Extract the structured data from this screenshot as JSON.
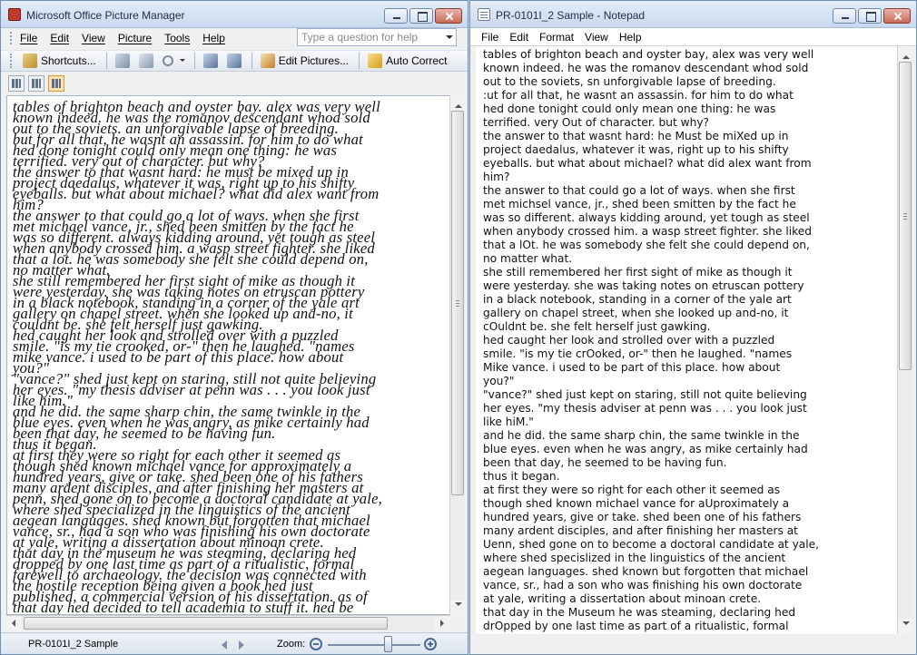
{
  "picture_manager": {
    "title": "Microsoft Office Picture Manager",
    "menu": [
      "File",
      "Edit",
      "View",
      "Picture",
      "Tools",
      "Help"
    ],
    "help_placeholder": "Type a question for help",
    "toolbar": {
      "shortcuts_label": "Shortcuts...",
      "edit_pictures_label": "Edit Pictures...",
      "auto_correct_label": "Auto Correct"
    },
    "document_lines": [
      "tables of brighton beach and oyster bay. alex was very well",
      "known indeed. he was the romanov descendant whod sold",
      "out to the soviets. an unforgivable lapse of breeding.",
      "but for all that, he wasnt an assassin. for him to do what",
      "hed done tonight could only mean one thing: he was",
      "terrified. very out of character. but why?",
      "the answer to that wasnt hard: he must be mixed up in",
      "project daedalus, whatever it was, right up to his shifty",
      "eyeballs. but what about michael? what did alex want from",
      "him?",
      "the answer to that could go a lot of ways. when she first",
      "met michael vance, jr., shed been smitten by the fact he",
      "was so different. always kidding around, yet tough as steel",
      "when anybody crossed him. a wasp street fighter. she liked",
      "that a lot. he was somebody she felt she could depend on,",
      "no matter what.",
      "she still remembered her first sight of mike as though it",
      "were yesterday. she was taking notes on etruscan pottery",
      "in a black notebook, standing in a corner of the yale art",
      "gallery on chapel street. when she looked up and-no, it",
      "couldnt be. she felt herself just gawking.",
      "hed caught her look and strolled over with a puzzled",
      "smile. \"is my tie crooked, or-\" then he laughed. \"names",
      "mike vance. i used to be part of this place. how about",
      "you?\"",
      "\"vance?\" shed just kept on staring, still not quite believing",
      "her eyes. \"my thesis adviser at penn was . . . you look just",
      "like him.\"",
      "and he did. the same sharp chin, the same twinkle in the",
      "blue eyes. even when he was angry, as mike certainly had",
      "been that day, he seemed to be having fun.",
      "thus it began.",
      "at first they were so right for each other it seemed as",
      "though shed known michael vance for approximately a",
      "hundred years, give or take. shed been one of his fathers",
      "many ardent disciples, and after finishing her masters at",
      "penn, shed gone on to become a doctoral candidate at yale,",
      "where shed specialized in the linguistics of the ancient",
      "aegean languages. shed known but forgotten that michael",
      "vance, sr., had a son who was finishing his own doctorate",
      "at yale, writing a dissertation about minoan crete.",
      "that day in the museum he was steaming, declaring hed",
      "dropped by one last time as part of a ritualistic, formal",
      "farewell to archaeology. the decision was connected with",
      "the hostile reception being given a book hed just",
      "published, a commercial version of his dissertation. as of",
      "that day hed decided to tell academia to stuff it. hed be"
    ],
    "status": {
      "file_name": "PR-0101I_2 Sample",
      "zoom_label": "Zoom:",
      "zoom_level": 0.66
    }
  },
  "notepad": {
    "title": "PR-0101I_2 Sample - Notepad",
    "menu": [
      "File",
      "Edit",
      "Format",
      "View",
      "Help"
    ],
    "document_lines": [
      "tables of brighton beach and oyster bay, alex was very well",
      "known indeed. he was the romanov descendant whod sold",
      "out to the soviets, sn unforgivable lapse of breeding.",
      ":ut for all that, he wasnt an assassin. for him to do what",
      "hed done tonight could only mean one thing: he was",
      "terrified. very Out of character. but why?",
      "the answer to that wasnt hard: he Must be miXed up in",
      "project daedalus, whatever it was, right up to his shifty",
      "eyeballs. but what about michael? what did alex want from",
      "him?",
      "the answer to that could go a lot of ways. when she first",
      "met michsel vance, jr., shed been smitten by the fact he",
      "was so different. always kidding around, yet tough as steel",
      "when anybody crossed him. a wasp street fighter. she liked",
      "that a lOt. he was somebody she felt she could depend on,",
      "no matter what.",
      "she still remembered her first sight of mike as though it",
      "were yesterday. she was taking notes on etruscan pottery",
      "in a black notebook, standing in a corner of the yale art",
      "gallery on chapel street, when she looked up and-no, it",
      "cOuldnt be. she felt herself just gawking.",
      "hed caught her look and strolled over with a puzzled",
      "smile. \"is my tie crOoked, or-\" then he laughed. \"names",
      "Mike vance. i used to be part of this place. how about",
      "you?\"",
      "\"vance?\" shed just kept on staring, still not quite believing",
      "her eyes. \"my thesis adviser at penn was . . . you look just",
      "like hiM.\"",
      "and he did. the same sharp chin, the same twinkle in the",
      "blue eyes. even when he was angry, as mike certainly had",
      "been that day, he seemed to be having fun.",
      "thus it began.",
      "at first they were so right for each other it seemed as",
      "though shed known michael vance for aUproximately a",
      "hundred years, give or take. shed been one of his fathers",
      "many ardent disciples, and after finishing her masters at",
      "Uenn, shed gone on to become a doctoral candidate at yale,",
      "where shed specislized in the linguistics of the ancient",
      "aegean languages. shed known but forgotten that michael",
      "vance, sr., had a son who was finishing his own doctorate",
      "at yale, writing a dissertation about minoan crete.",
      "that day in the Museum he was steaming, declaring hed",
      "drOpped by one last time as part of a ritualistic, formal"
    ]
  },
  "icons": {
    "picture_manager_app": "picture-manager-app-icon",
    "notepad_app": "notepad-app-icon"
  },
  "colors": {
    "title_text": "#1e2d44",
    "window_border": "#6f8fb6",
    "close_button": "#c96a57"
  }
}
